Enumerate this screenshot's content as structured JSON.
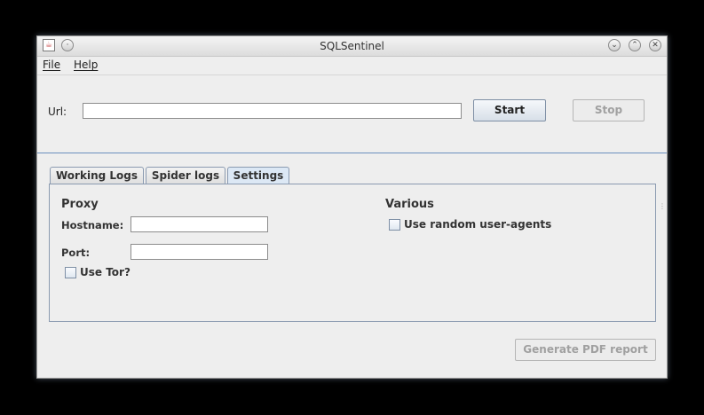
{
  "window": {
    "title": "SQLSentinel"
  },
  "menu": {
    "file": "File",
    "help": "Help"
  },
  "url": {
    "label": "Url:",
    "value": ""
  },
  "buttons": {
    "start": "Start",
    "stop": "Stop",
    "generate_pdf": "Generate PDF report"
  },
  "tabs": [
    "Working Logs",
    "Spider logs",
    "Settings"
  ],
  "settings": {
    "proxy_title": "Proxy",
    "hostname_label": "Hostname:",
    "hostname_value": "",
    "port_label": "Port:",
    "port_value": "",
    "use_tor_label": "Use Tor?",
    "use_tor_checked": false,
    "various_title": "Various",
    "random_agents_label": "Use random user-agents",
    "random_agents_checked": false
  },
  "colors": {
    "separator": "#6a8fbe",
    "active_tab": "#dce8f5"
  }
}
